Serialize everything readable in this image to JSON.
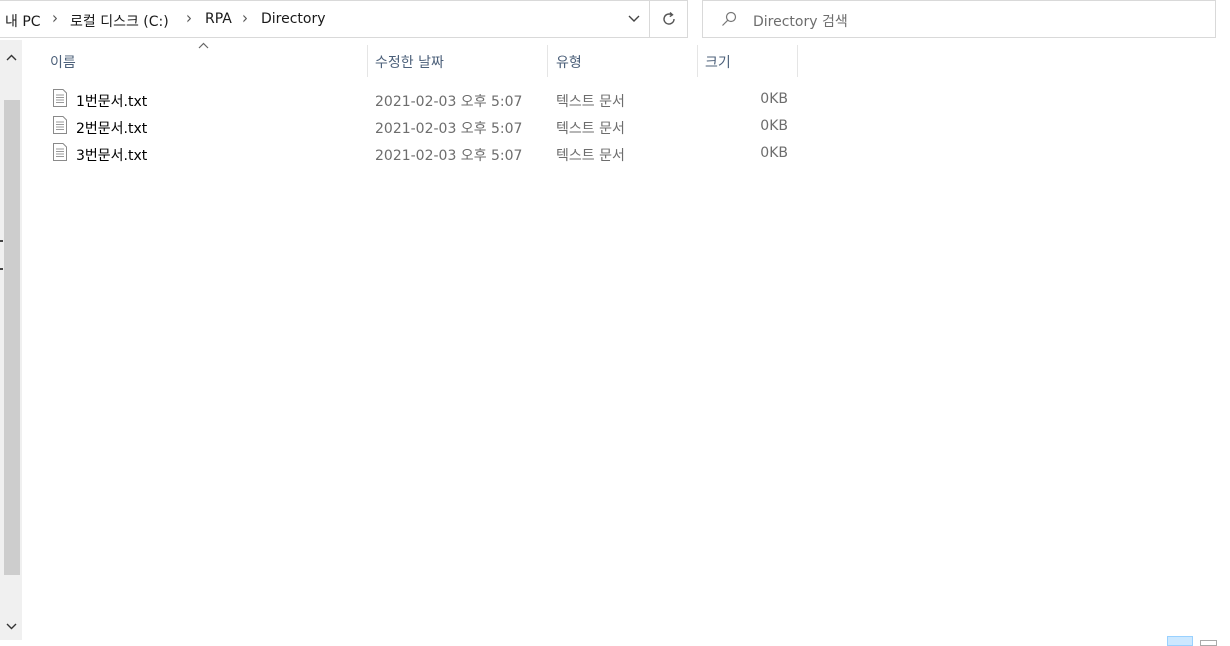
{
  "address_bar": {
    "breadcrumbs": [
      "내 PC",
      "로컬 디스크 (C:)",
      "RPA",
      "Directory"
    ]
  },
  "search": {
    "placeholder": "Directory 검색"
  },
  "columns": {
    "name": "이름",
    "date": "수정한 날짜",
    "type": "유형",
    "size": "크기"
  },
  "files": [
    {
      "name": "1번문서.txt",
      "date": "2021-02-03 오후 5:07",
      "type": "텍스트 문서",
      "size": "0KB"
    },
    {
      "name": "2번문서.txt",
      "date": "2021-02-03 오후 5:07",
      "type": "텍스트 문서",
      "size": "0KB"
    },
    {
      "name": "3번문서.txt",
      "date": "2021-02-03 오후 5:07",
      "type": "텍스트 문서",
      "size": "0KB"
    }
  ],
  "icons": {
    "breadcrumb_separator": "chevron-right-icon",
    "address_dropdown": "chevron-down-icon",
    "refresh": "refresh-icon",
    "search": "search-icon",
    "file": "text-file-icon",
    "sort": "sort-ascending-icon"
  }
}
